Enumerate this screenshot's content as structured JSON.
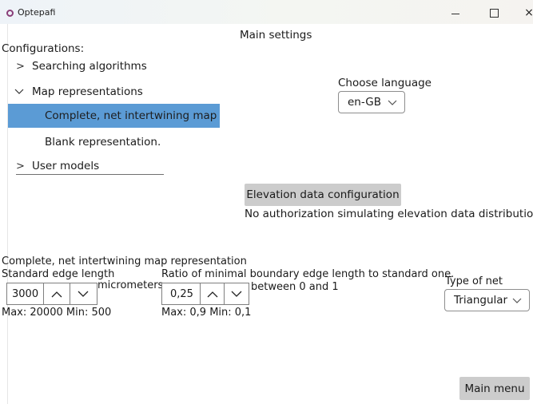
{
  "window": {
    "title": "Optepafi",
    "icon": "app-ring-icon",
    "controls": {
      "minimize": "minimize-icon",
      "maximize": "maximize-icon",
      "close": "×"
    }
  },
  "header": {
    "title": "Main settings"
  },
  "configurations": {
    "label": "Configurations:",
    "items": [
      {
        "label": "Searching algorithms",
        "expanded": false,
        "chevron": ">"
      },
      {
        "label": "Map representations",
        "expanded": true,
        "chevron": "v"
      },
      {
        "label": "Complete, net intertwining map re",
        "selected": true
      },
      {
        "label": "Blank representation."
      },
      {
        "label": "User models",
        "expanded": false,
        "chevron": ">"
      }
    ]
  },
  "language": {
    "label": "Choose language",
    "value": "en-GB"
  },
  "elevation": {
    "button_label": "Elevation data configuration",
    "status": "No authorization simulating elevation data distribution"
  },
  "representation": {
    "title": "Complete, net intertwining map representation",
    "edge_length": {
      "label": "Standard edge length",
      "value": "3000",
      "unit": "micrometers",
      "limits": "Max: 20000 Min: 500"
    },
    "ratio": {
      "label": "Ratio of minimal boundary edge length to standard one.",
      "value": "0,25",
      "hint": "between 0 and 1",
      "limits": "Max: 0,9 Min: 0,1"
    },
    "net_type": {
      "label": "Type of net",
      "value": "Triangular"
    }
  },
  "footer": {
    "main_menu_label": "Main menu"
  },
  "colors": {
    "selection": "#5b9bd5",
    "button": "#cccccc",
    "app_icon": "#8a3e79"
  }
}
